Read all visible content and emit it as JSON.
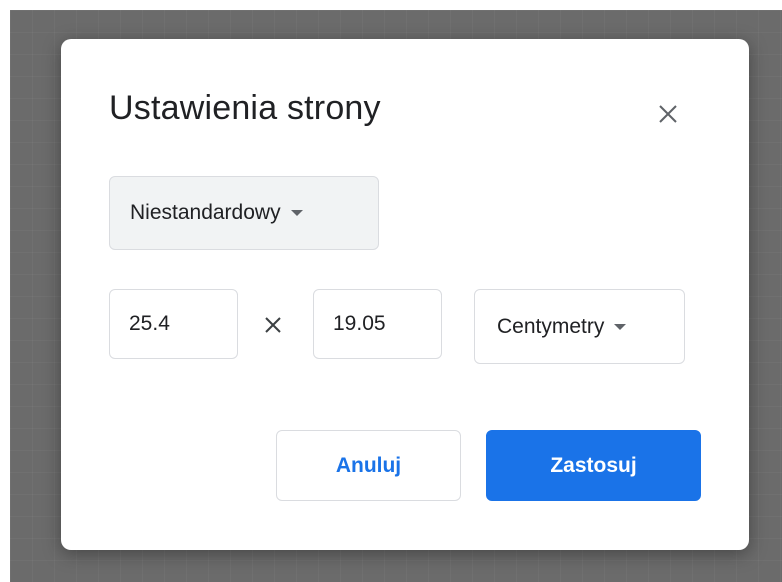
{
  "dialog": {
    "title": "Ustawienia strony",
    "preset_value": "Niestandardowy",
    "width_value": "25.4",
    "height_value": "19.05",
    "unit_value": "Centymetry",
    "cancel_label": "Anuluj",
    "apply_label": "Zastosuj"
  },
  "icons": {
    "close": "close-icon",
    "dropdown": "caret-down-icon",
    "times": "multiply-icon"
  },
  "colors": {
    "accent": "#1a73e8",
    "backdrop": "#6b6b6b"
  }
}
